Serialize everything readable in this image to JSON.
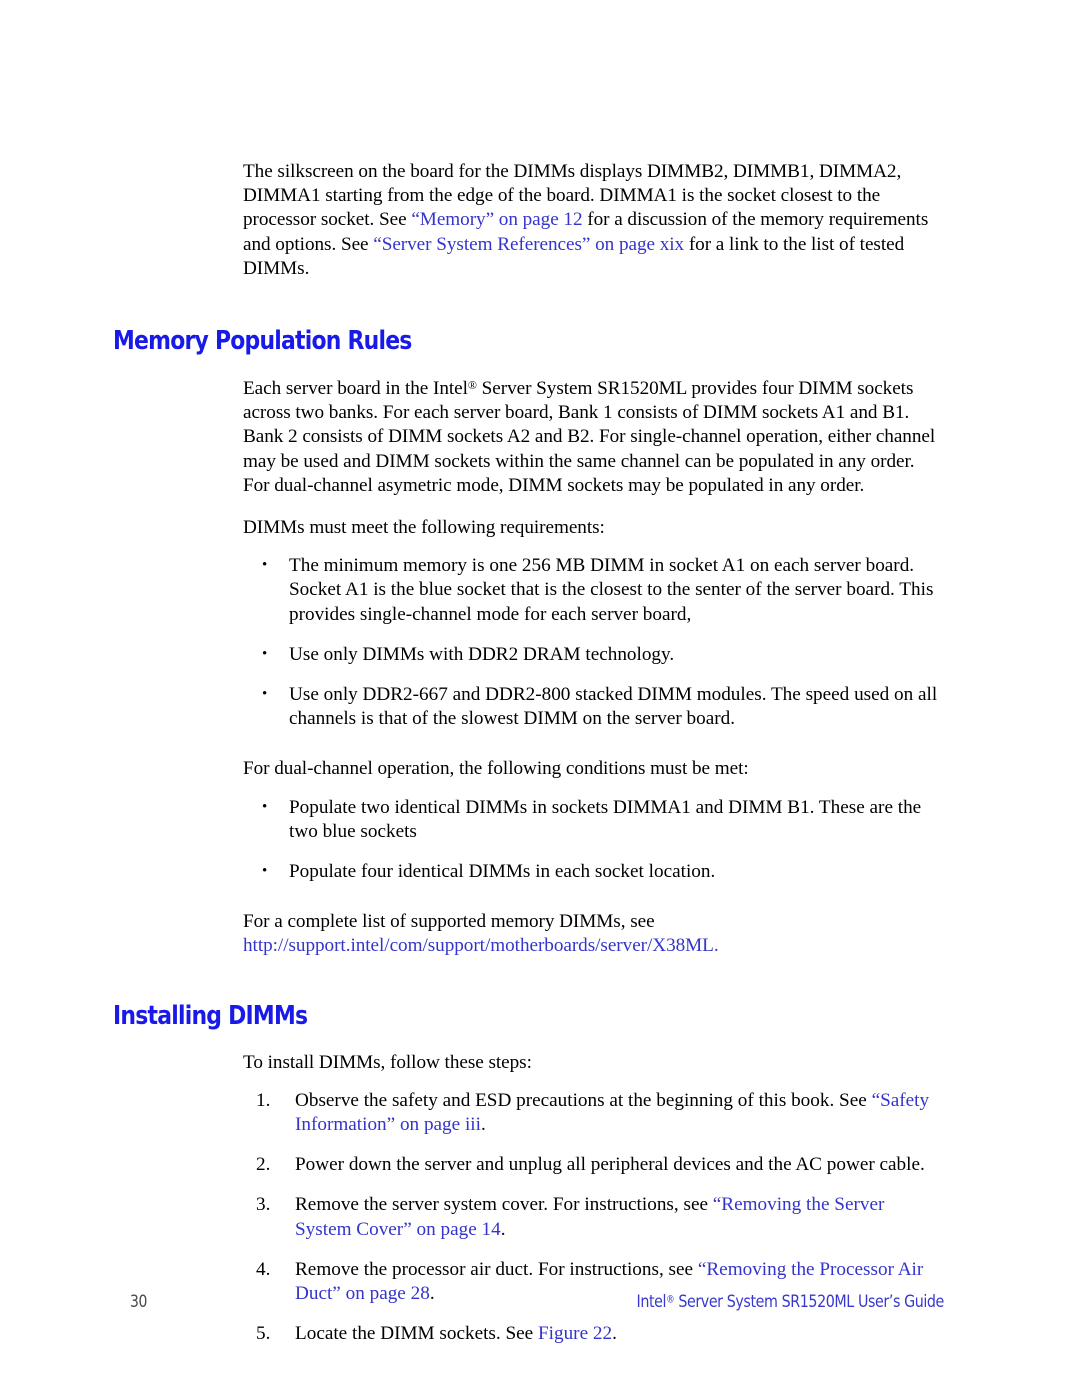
{
  "document": {
    "page_number": "30",
    "footer_title_prefix": "Intel",
    "footer_title_sup": "®",
    "footer_title_rest": " Server System SR1520ML User’s Guide"
  },
  "intro": {
    "part1": "The silkscreen on the board for the DIMMs displays DIMMB2, DIMMB1, DIMMA2, DIMMA1 starting from the edge of the board. DIMMA1 is the socket closest to the processor socket. See ",
    "link1": "“Memory” on page 12",
    "part2": " for a discussion of the memory requirements and options. See ",
    "link2": "“Server System References” on page xix",
    "part3": " for a link to the list of tested DIMMs."
  },
  "memory_population_rules": {
    "heading": "Memory Population Rules",
    "paragraph1_a": "Each server board in the Intel",
    "paragraph1_sup": "®",
    "paragraph1_b": " Server System SR1520ML provides four DIMM sockets across two banks. For each server board, Bank 1 consists of DIMM sockets A1 and B1. Bank 2 consists of DIMM sockets A2 and B2. For single-channel operation, either channel may be used and DIMM sockets within the same channel can be populated in any order. For dual-channel asymetric mode, DIMM sockets may be populated in any order.",
    "requirements_lead": "DIMMs must meet the following requirements:",
    "requirements": [
      "The minimum memory is one 256 MB DIMM in socket A1 on each server board. Socket A1 is the blue socket that is the closest to the senter of the server board. This provides single-channel mode for each server board,",
      "Use only DIMMs with DDR2 DRAM technology.",
      "Use only DDR2-667 and DDR2-800 stacked DIMM modules. The speed used on all channels is that of the slowest DIMM on the server board."
    ],
    "dual_channel_lead": "For dual-channel operation, the following conditions must be met:",
    "dual_channel_items": [
      "Populate two identical DIMMs in sockets DIMMA1 and DIMM B1. These are the two blue sockets",
      "Populate four identical DIMMs in each socket location."
    ],
    "supported_list_text": "For a complete list of supported memory DIMMs, see ",
    "supported_list_url": "http://support.intel/com/support/motherboards/server/X38ML",
    "supported_list_tail": "."
  },
  "installing_dimms": {
    "heading": "Installing DIMMs",
    "lead": "To install DIMMs, follow these steps:",
    "steps": [
      {
        "text_before": "Observe the safety and ESD precautions at the beginning of this book. See ",
        "link": "“Safety Information” on page iii",
        "text_after": "."
      },
      {
        "text_before": "Power down the server and unplug all peripheral devices and the AC power cable.",
        "link": "",
        "text_after": ""
      },
      {
        "text_before": "Remove the server system cover. For instructions, see ",
        "link": "“Removing the Server System Cover” on page 14",
        "text_after": "."
      },
      {
        "text_before": "Remove the processor air duct. For instructions, see ",
        "link": "“Removing the Processor Air Duct” on page 28",
        "text_after": "."
      },
      {
        "text_before": "Locate the DIMM sockets. See ",
        "link": "Figure 22",
        "text_after": "."
      }
    ]
  },
  "colors": {
    "heading_blue": "#1a1ae8",
    "link_blue": "#3434cc",
    "footer_blue": "#3838cf",
    "body_black": "#000000",
    "page_background": "#ffffff"
  }
}
